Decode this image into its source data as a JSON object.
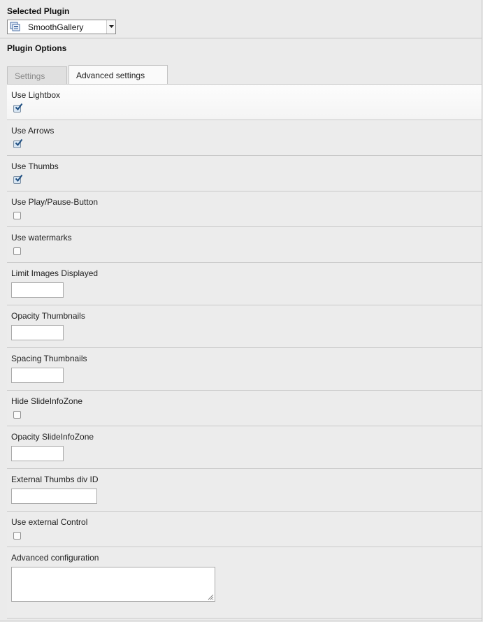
{
  "selected_plugin": {
    "heading": "Selected Plugin",
    "select": {
      "value": "SmoothGallery",
      "icon": "gallery-icon"
    }
  },
  "plugin_options": {
    "heading": "Plugin Options",
    "tabs": [
      {
        "label": "Settings",
        "active": false
      },
      {
        "label": "Advanced settings",
        "active": true
      }
    ]
  },
  "fields": {
    "use_lightbox": {
      "label": "Use Lightbox",
      "checked": true
    },
    "use_arrows": {
      "label": "Use Arrows",
      "checked": true
    },
    "use_thumbs": {
      "label": "Use Thumbs",
      "checked": true
    },
    "use_play_pause": {
      "label": "Use Play/Pause-Button",
      "checked": false
    },
    "use_watermarks": {
      "label": "Use watermarks",
      "checked": false
    },
    "limit_images": {
      "label": "Limit Images Displayed",
      "value": ""
    },
    "opacity_thumbnails": {
      "label": "Opacity Thumbnails",
      "value": ""
    },
    "spacing_thumbnails": {
      "label": "Spacing Thumbnails",
      "value": ""
    },
    "hide_slideinfozone": {
      "label": "Hide SlideInfoZone",
      "checked": false
    },
    "opacity_slideinfozone": {
      "label": "Opacity SlideInfoZone",
      "value": ""
    },
    "external_thumbs_div_id": {
      "label": "External Thumbs div ID",
      "value": ""
    },
    "use_external_control": {
      "label": "Use external Control",
      "checked": false
    },
    "advanced_configuration": {
      "label": "Advanced configuration",
      "value": ""
    }
  },
  "colors": {
    "check_accent": "#2a5d8f",
    "panel_bg": "#ececec",
    "border": "#c9c9c9"
  }
}
